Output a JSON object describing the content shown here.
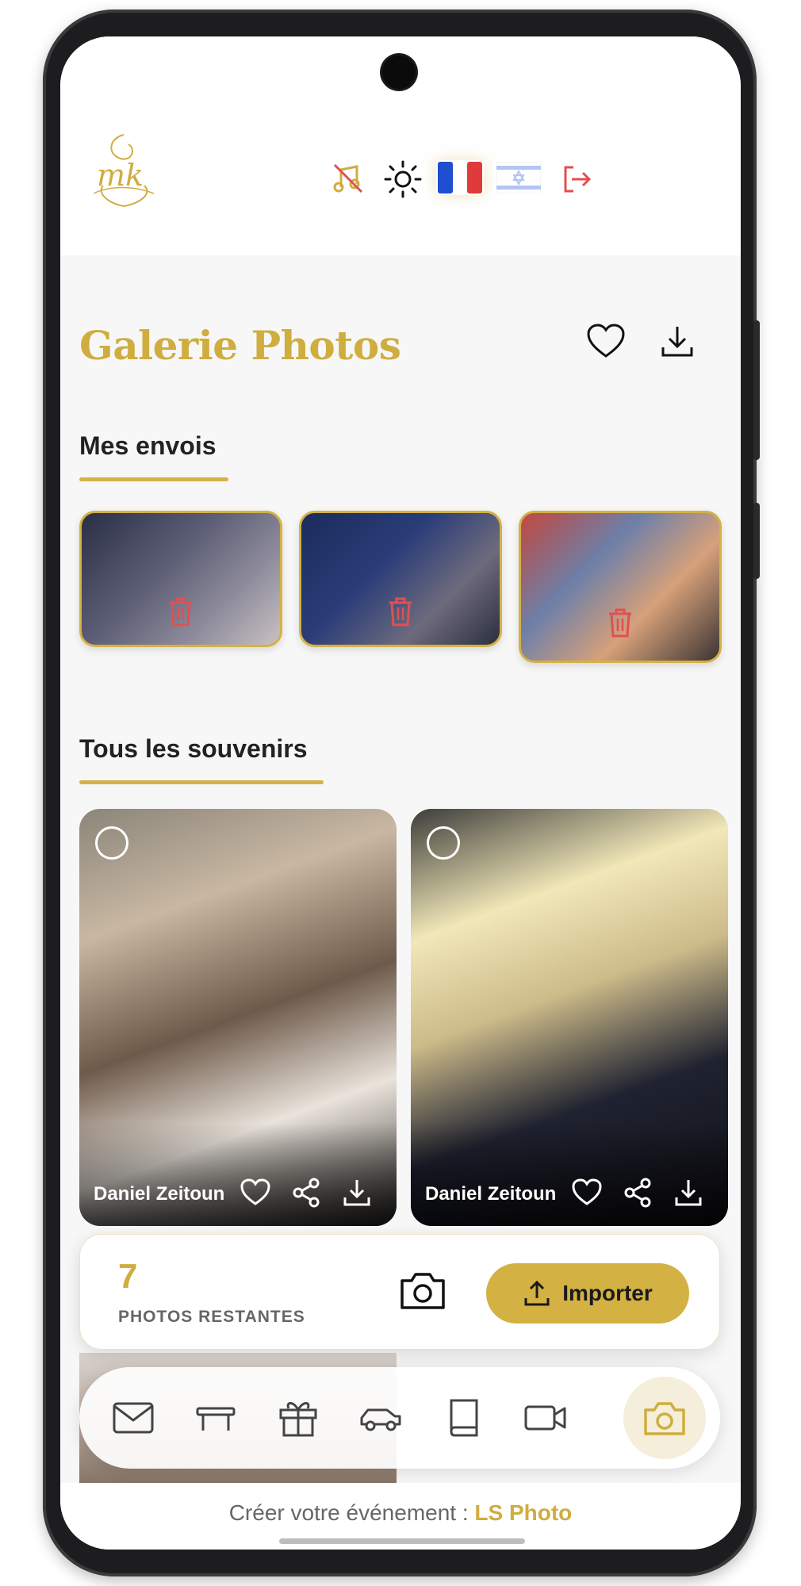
{
  "app": {
    "logo_text": "mk",
    "title": "Galerie Photos"
  },
  "topbar": {
    "icons": [
      "music-off-icon",
      "sun-icon",
      "flag-fr-icon",
      "flag-il-icon",
      "logout-icon"
    ],
    "accent": "#cfad3f",
    "logout_color": "#e05050"
  },
  "header_actions": [
    "heart-icon",
    "download-icon"
  ],
  "sections": {
    "my_uploads": "Mes envois",
    "all_memories": "Tous les souvenirs"
  },
  "my_uploads": [
    {
      "name": "photo-1"
    },
    {
      "name": "photo-2"
    },
    {
      "name": "photo-3"
    }
  ],
  "gallery": [
    {
      "author": "Daniel Zeitoun"
    },
    {
      "author": "Daniel Zeitoun"
    }
  ],
  "quota": {
    "count": "7",
    "label": "PHOTOS RESTANTES",
    "import_label": "Importer"
  },
  "tabbar": {
    "items": [
      "mail-icon",
      "table-icon",
      "gift-icon",
      "car-icon",
      "book-icon",
      "video-icon",
      "camera-icon"
    ],
    "active": "camera-icon"
  },
  "footer": {
    "prefix": "Créer votre événement :",
    "brand": "LS Photo"
  }
}
